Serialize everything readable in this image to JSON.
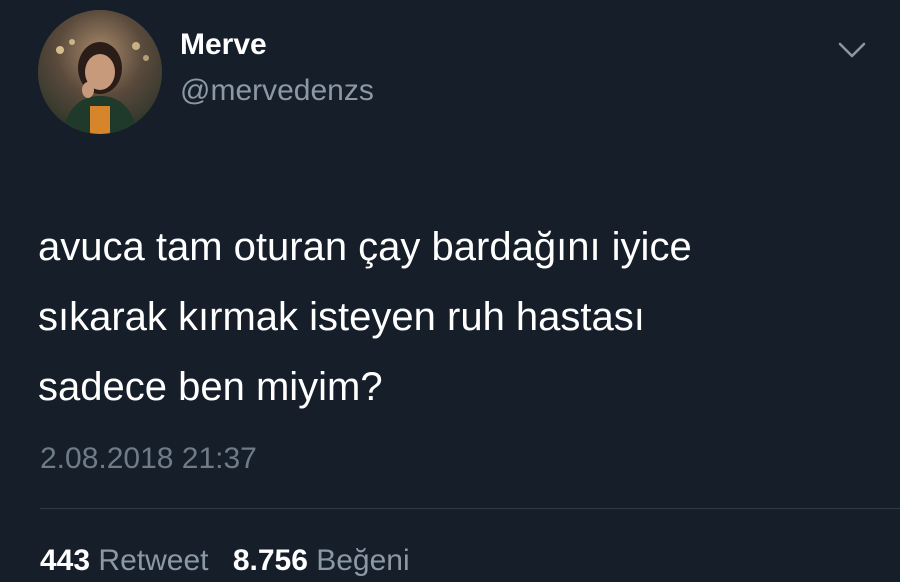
{
  "author": {
    "display_name": "Merve",
    "handle": "@mervedenzs",
    "avatar_icon": "profile-photo"
  },
  "menu": {
    "icon": "chevron-down-icon"
  },
  "tweet": {
    "lines": [
      "avuca tam oturan çay bardağını iyice",
      "sıkarak kırmak isteyen ruh hastası",
      "sadece ben miyim?"
    ],
    "timestamp": "2.08.2018 21:37"
  },
  "stats": {
    "retweets": {
      "count": "443",
      "label": "Retweet"
    },
    "likes": {
      "count": "8.756",
      "label": "Beğeni"
    }
  },
  "colors": {
    "background": "#161e2a",
    "primary_text": "#ffffff",
    "secondary_text": "#8b98a5",
    "divider": "#2f3a47"
  }
}
